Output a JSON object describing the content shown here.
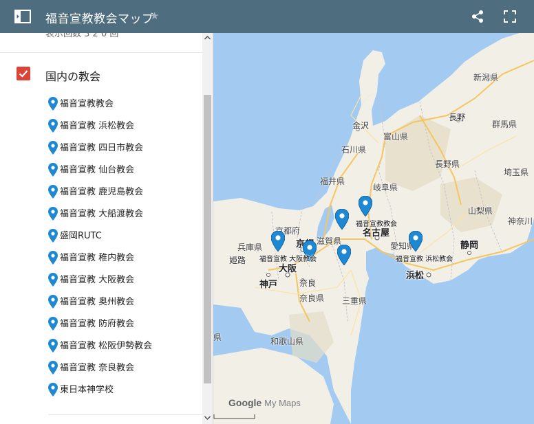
{
  "header": {
    "title": "福音宣教教会マップ",
    "star_glyph": "★"
  },
  "sidebar": {
    "clipped_text": "表示回数 3 2 0 回",
    "layer": {
      "name": "国内の教会",
      "checked": true
    },
    "places": [
      "福音宣教教会",
      "福音宣教 浜松教会",
      "福音宣教 四日市教会",
      "福音宣教 仙台教会",
      "福音宣教 鹿児島教会",
      "福音宣教 大船渡教会",
      "盛岡RUTC",
      "福音宣教 稚内教会",
      "福音宣教 大阪教会",
      "福音宣教 奥州教会",
      "福音宣教 防府教会",
      "福音宣教 松阪伊勢教会",
      "福音宣教 奈良教会",
      "東日本神学校"
    ]
  },
  "map": {
    "prefectures": [
      "新潟県",
      "富山県",
      "石川県",
      "長野県",
      "群馬県",
      "福井県",
      "岐阜県",
      "埼玉県",
      "山梨県",
      "神奈川",
      "京都府",
      "滋賀県",
      "兵庫県",
      "愛知県",
      "三重県",
      "奈良県",
      "和歌山県",
      "県"
    ],
    "cities": [
      "金沢",
      "長野",
      "名古屋",
      "京都",
      "大阪",
      "神戸",
      "姫路",
      "奈良",
      "静岡",
      "浜松"
    ],
    "marker_labels": [
      "福音宣教教会",
      "福音宣教 大阪教会",
      "福音宣教 浜松教会"
    ],
    "attribution": {
      "google": "Google",
      "mymaps": "My Maps"
    }
  },
  "colors": {
    "header": "#4e6e80",
    "accent": "#db4437",
    "pin": "#1e88d2",
    "sea": "#a3cbf2",
    "land": "#f2efe6"
  }
}
